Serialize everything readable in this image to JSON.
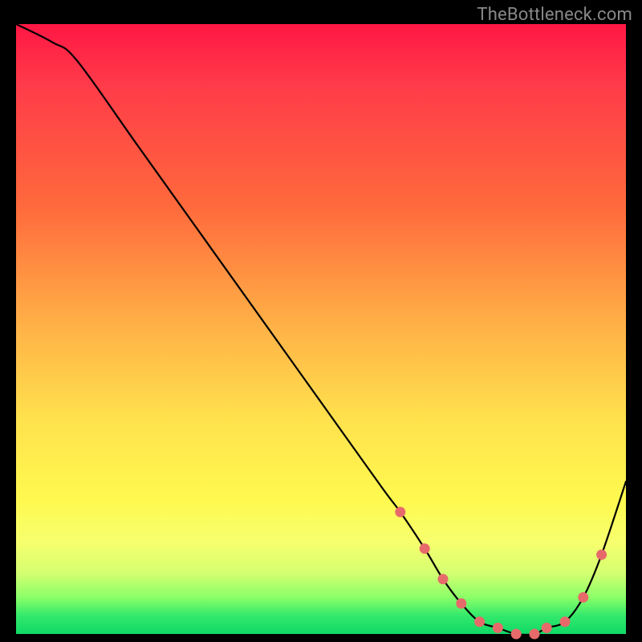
{
  "attribution": "TheBottleneck.com",
  "chart_data": {
    "type": "line",
    "title": "",
    "xlabel": "",
    "ylabel": "",
    "xlim": [
      0,
      100
    ],
    "ylim": [
      0,
      100
    ],
    "series": [
      {
        "name": "bottleneck-curve",
        "x": [
          0,
          6,
          10,
          20,
          30,
          40,
          50,
          60,
          63,
          67,
          70,
          73,
          76,
          79,
          82,
          85,
          87,
          90,
          93,
          96,
          100
        ],
        "values": [
          100,
          97,
          94,
          80,
          66,
          52,
          38,
          24,
          20,
          14,
          9,
          5,
          2,
          1,
          0,
          0,
          1,
          2,
          6,
          13,
          25
        ]
      }
    ],
    "markers": {
      "name": "highlight-dots",
      "x": [
        63,
        67,
        70,
        73,
        76,
        79,
        82,
        85,
        87,
        90,
        93,
        96
      ],
      "values": [
        20,
        14,
        9,
        5,
        2,
        1,
        0,
        0,
        1,
        2,
        6,
        13
      ]
    },
    "background_gradient_stops": [
      {
        "pos": 0,
        "color": "#ff1744"
      },
      {
        "pos": 10,
        "color": "#ff3b49"
      },
      {
        "pos": 30,
        "color": "#ff6a3c"
      },
      {
        "pos": 50,
        "color": "#ffb347"
      },
      {
        "pos": 65,
        "color": "#ffe24d"
      },
      {
        "pos": 78,
        "color": "#fff94f"
      },
      {
        "pos": 85,
        "color": "#f7ff6e"
      },
      {
        "pos": 90,
        "color": "#d4ff70"
      },
      {
        "pos": 94,
        "color": "#8aff68"
      },
      {
        "pos": 97,
        "color": "#33e96b"
      },
      {
        "pos": 100,
        "color": "#0fd866"
      }
    ],
    "marker_color": "#e76a6a",
    "line_color": "#000000"
  }
}
